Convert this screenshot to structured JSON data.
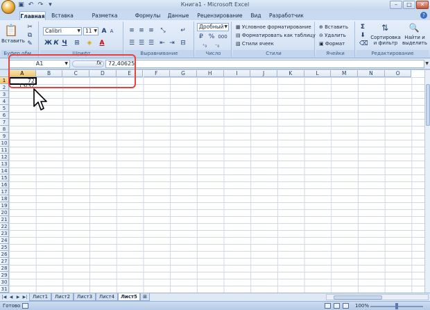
{
  "window": {
    "title": "Книга1 - Microsoft Excel"
  },
  "ribbon": {
    "tabs": [
      {
        "label": "Главная",
        "active": true
      },
      {
        "label": "Вставка"
      },
      {
        "label": "Разметка страницы"
      },
      {
        "label": "Формулы"
      },
      {
        "label": "Данные"
      },
      {
        "label": "Рецензирование"
      },
      {
        "label": "Вид"
      },
      {
        "label": "Разработчик"
      }
    ],
    "clipboard": {
      "paste_label": "Вставить",
      "group_label": "Буфер обм..."
    },
    "font": {
      "name": "Calibri",
      "size": "11",
      "bold": "Ж",
      "italic": "К",
      "underline": "Ч",
      "group_label": "Шрифт"
    },
    "alignment": {
      "group_label": "Выравнивание"
    },
    "number": {
      "format": "Дробный",
      "percent": "%",
      "thousands": "000",
      "group_label": "Число"
    },
    "styles": {
      "conditional": "Условное форматирование",
      "as_table": "Форматировать как таблицу",
      "cell_styles": "Стили ячеек",
      "group_label": "Стили"
    },
    "cells": {
      "insert": "Вставить",
      "delete": "Удалить",
      "format": "Формат",
      "group_label": "Ячейки"
    },
    "editing": {
      "sigma": "Σ",
      "sort_line1": "Сортировка",
      "sort_line2": "и фильтр",
      "find_line1": "Найти и",
      "find_line2": "выделить",
      "group_label": "Редактирование"
    }
  },
  "formula_bar": {
    "name_box": "A1",
    "fx": "fx",
    "value": "72,40625"
  },
  "grid": {
    "columns": [
      "A",
      "B",
      "C",
      "D",
      "E",
      "F",
      "G",
      "H",
      "I",
      "J",
      "K",
      "L",
      "M",
      "N",
      "O"
    ],
    "rows": [
      "1",
      "2",
      "3",
      "4",
      "5",
      "6",
      "7",
      "8",
      "9",
      "10",
      "11",
      "12",
      "13",
      "14",
      "15",
      "16",
      "17",
      "18",
      "19",
      "20",
      "21",
      "22",
      "23",
      "24",
      "25",
      "26",
      "27",
      "28",
      "29",
      "30",
      "31"
    ],
    "active_cell": "A1",
    "active_value": "72 13/32"
  },
  "sheets": {
    "tabs": [
      "Лист1",
      "Лист2",
      "Лист3",
      "Лист4",
      "Лист5"
    ],
    "active": "Лист5"
  },
  "status": {
    "ready": "Готово",
    "zoom": "100%"
  }
}
